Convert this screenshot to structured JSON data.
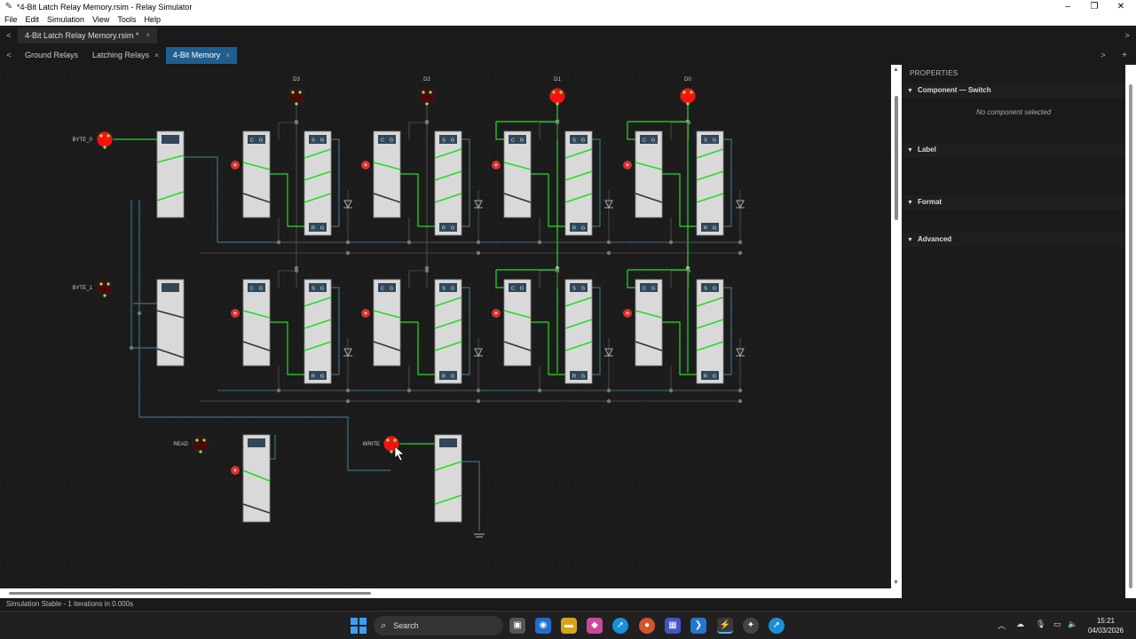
{
  "window": {
    "title": "*4-Bit Latch Relay Memory.rsim - Relay Simulator",
    "minimize": "–",
    "maximize": "❐",
    "close": "✕"
  },
  "menu": [
    "File",
    "Edit",
    "Simulation",
    "View",
    "Tools",
    "Help"
  ],
  "file_tab": {
    "label": "4-Bit Latch Relay Memory.rsim *",
    "close": "×",
    "left_arrow": "<",
    "right_arrow": ">"
  },
  "page_tabs": {
    "left_arrow": "<",
    "right_arrow": ">",
    "add": "+",
    "items": [
      {
        "label": "Ground Relays",
        "closable": false,
        "active": false
      },
      {
        "label": "Latching Relays",
        "closable": true,
        "active": false
      },
      {
        "label": "4-Bit Memory",
        "closable": true,
        "active": true
      }
    ],
    "close": "×"
  },
  "circuit": {
    "data_outputs": [
      {
        "label": "D3",
        "on": false
      },
      {
        "label": "D2",
        "on": false
      },
      {
        "label": "D1",
        "on": true
      },
      {
        "label": "D0",
        "on": true
      }
    ],
    "byte_switches": [
      {
        "label": "BYTE_0",
        "on": true
      },
      {
        "label": "BYTE_1",
        "on": false
      }
    ],
    "read_switch": {
      "label": "READ",
      "on": false
    },
    "write_switch": {
      "label": "WRITE",
      "on": true
    },
    "coil_label_set": "S",
    "coil_label_reset": "R",
    "coil_label_common": "C",
    "coil_label_gnd": "G"
  },
  "properties": {
    "header": "PROPERTIES",
    "sections": [
      {
        "label": "Component — Switch",
        "message": "No component selected"
      },
      {
        "label": "Label"
      },
      {
        "label": "Format"
      },
      {
        "label": "Advanced"
      }
    ]
  },
  "status": "Simulation Stable - 1 iterations in 0.000s",
  "taskbar": {
    "search": "Search",
    "time": "15:21",
    "date": "04/03/2026"
  },
  "colors": {
    "wire_active": "#22dd22",
    "wire_idle": "#3f6f83",
    "wire_ground": "#555555",
    "led_on": "#ff1010",
    "led_off": "#4a0a0a",
    "tab_active": "#1f5e8e"
  }
}
